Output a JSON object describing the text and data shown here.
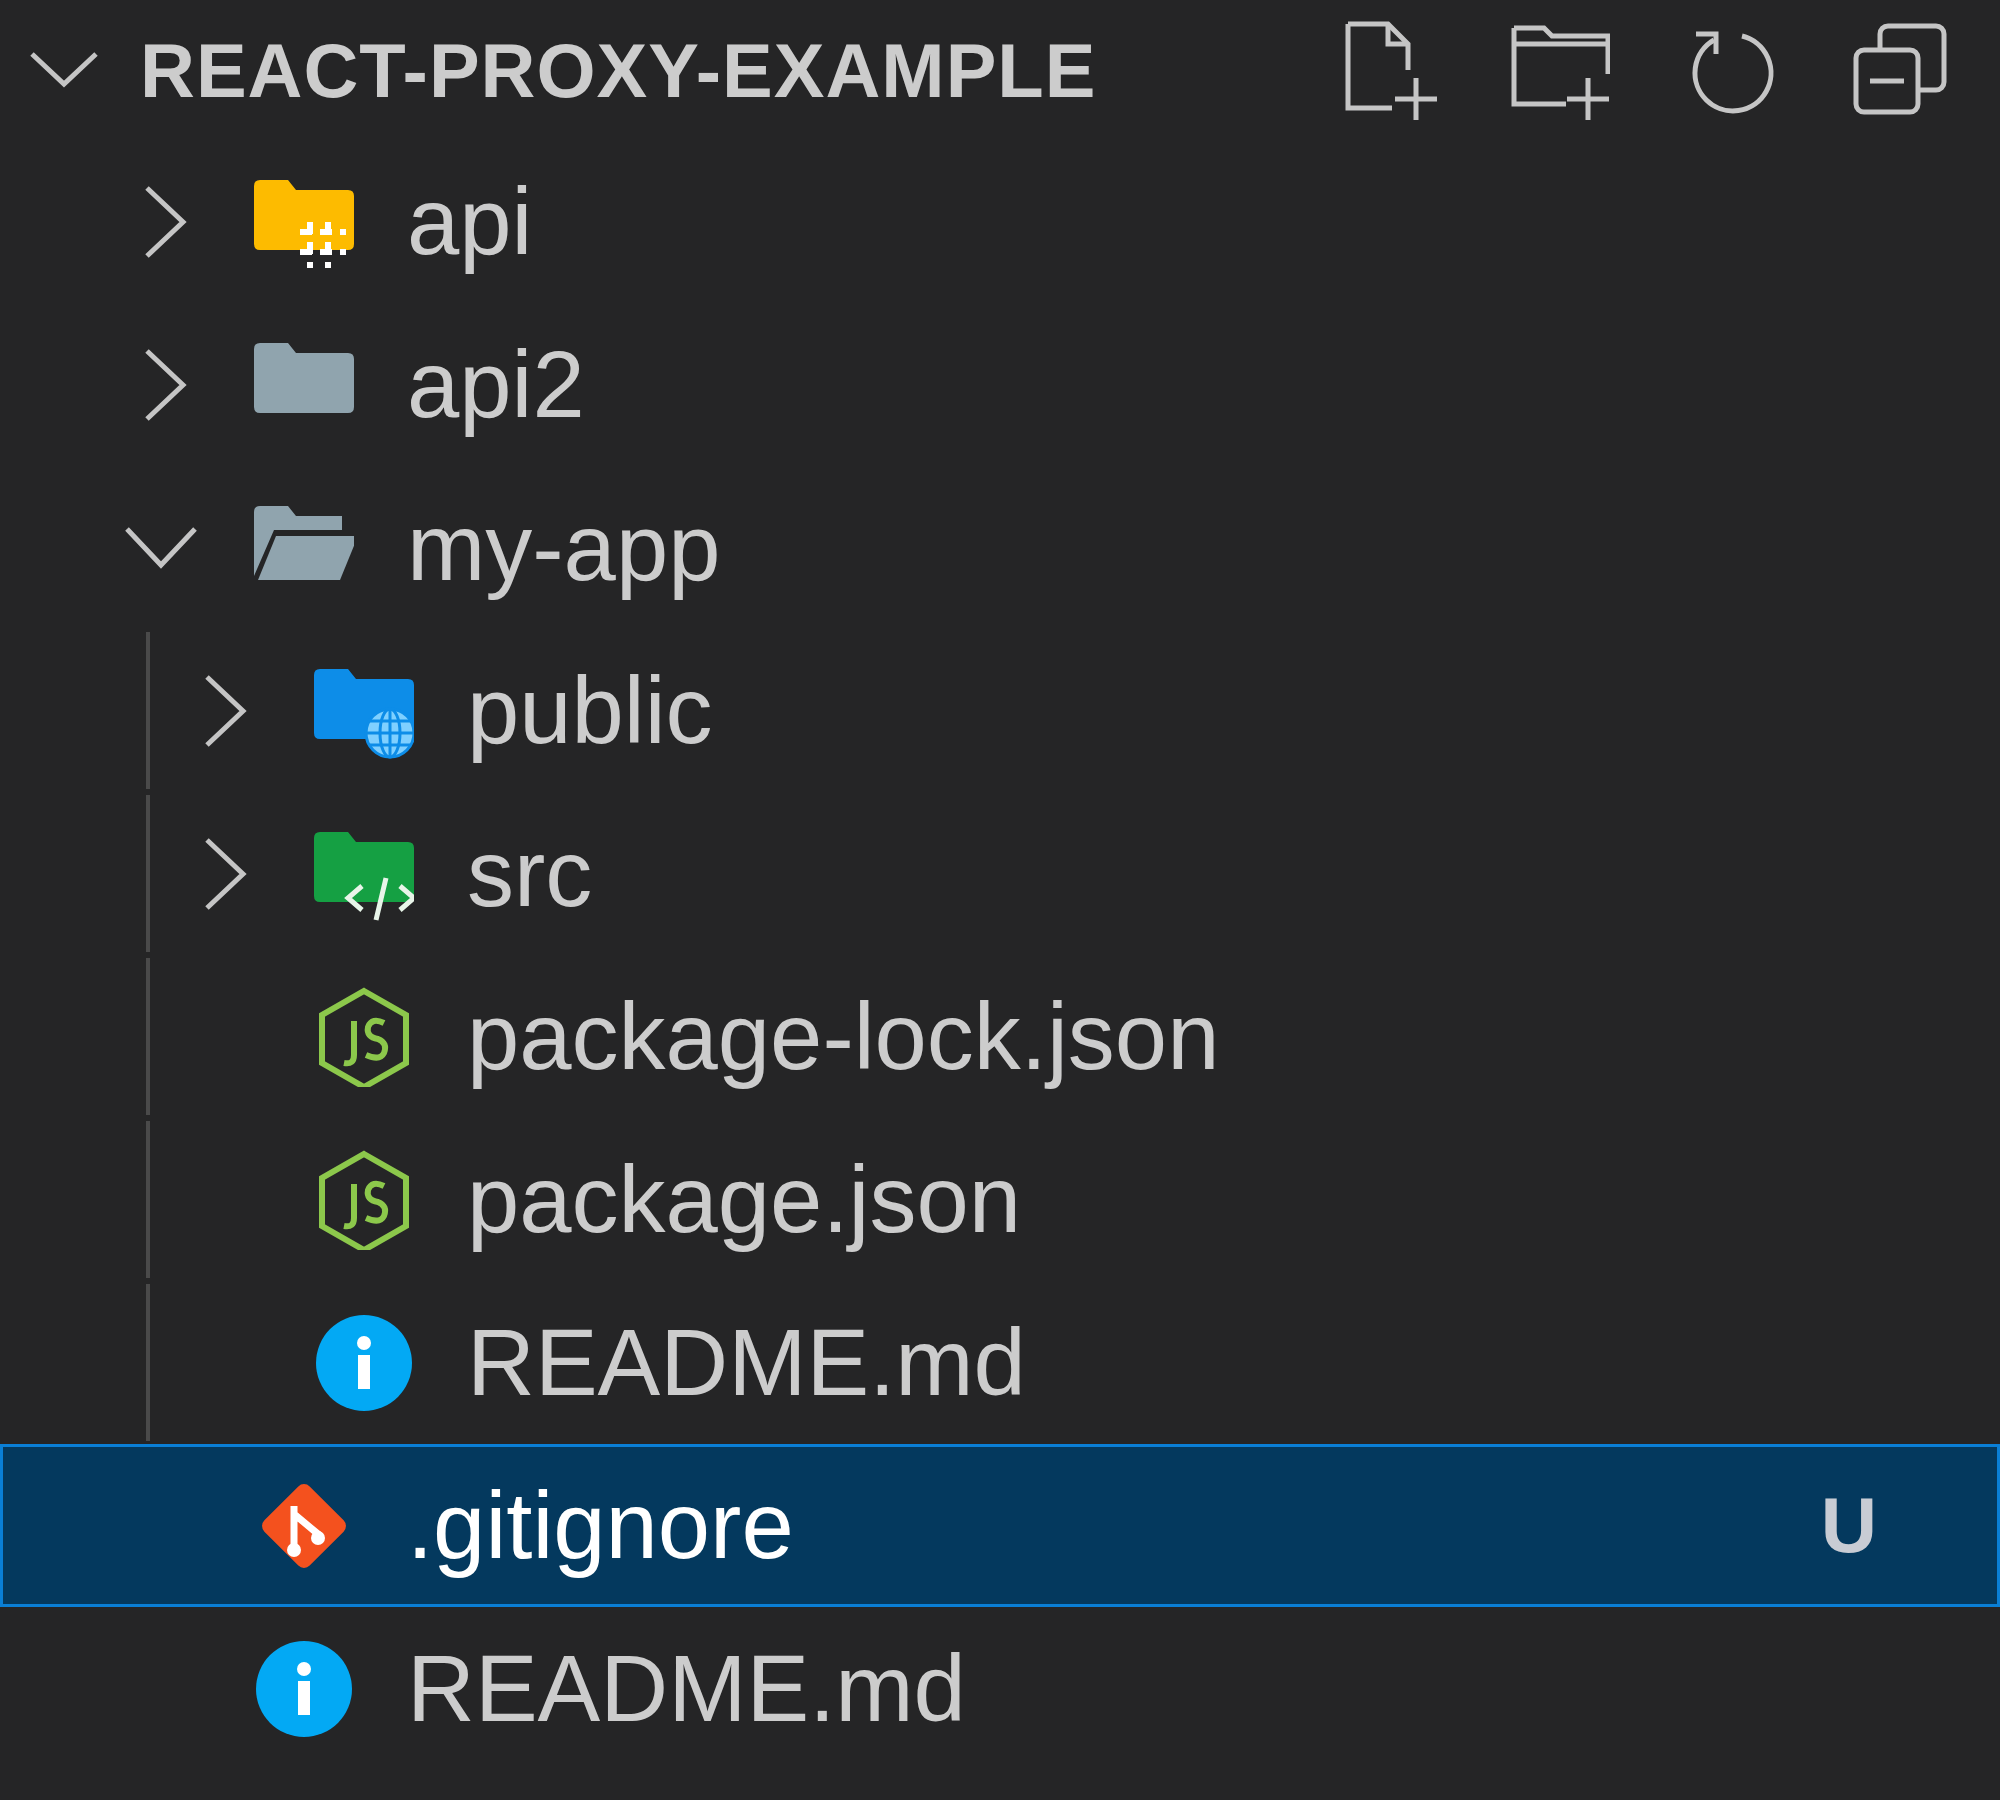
{
  "header": {
    "title": "REACT-PROXY-EXAMPLE",
    "expanded": true
  },
  "tree": [
    {
      "name": "api",
      "kind": "api",
      "expanded": false,
      "selected": false
    },
    {
      "name": "api2",
      "kind": "folder",
      "expanded": false,
      "selected": false
    },
    {
      "name": "my-app",
      "kind": "folder",
      "expanded": true,
      "selected": false,
      "children": [
        {
          "name": "public",
          "kind": "public",
          "expanded": false,
          "selected": false
        },
        {
          "name": "src",
          "kind": "src",
          "expanded": false,
          "selected": false
        },
        {
          "name": "package-lock.json",
          "kind": "node",
          "selected": false
        },
        {
          "name": "package.json",
          "kind": "node",
          "selected": false
        },
        {
          "name": "README.md",
          "kind": "info",
          "selected": false
        }
      ]
    },
    {
      "name": ".gitignore",
      "kind": "git",
      "selected": true,
      "badge": "U"
    },
    {
      "name": "README.md",
      "kind": "info",
      "selected": false
    }
  ]
}
